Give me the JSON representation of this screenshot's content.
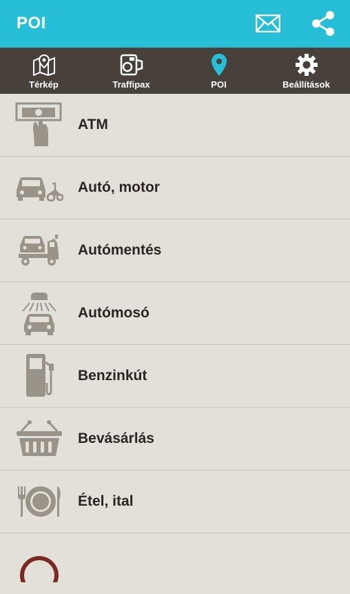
{
  "appbar": {
    "title": "POI",
    "actions": [
      {
        "icon": "mail-icon"
      },
      {
        "icon": "share-icon"
      }
    ]
  },
  "tabs": [
    {
      "label": "Térkép",
      "icon": "map-icon",
      "active": false
    },
    {
      "label": "Traffipax",
      "icon": "speed-camera-icon",
      "active": false
    },
    {
      "label": "POI",
      "icon": "location-pin-icon",
      "active": true
    },
    {
      "label": "Beállítások",
      "icon": "gear-icon",
      "active": false
    }
  ],
  "colors": {
    "appbar": "#27bfd8",
    "tabbar": "#48413b",
    "background": "#e3e0da",
    "icon_gray": "#9a938a",
    "text": "#2a2522",
    "active_tab": "#27bfd8"
  },
  "poi_list": [
    {
      "label": "ATM",
      "icon": "atm-icon"
    },
    {
      "label": "Autó, motor",
      "icon": "car-motorbike-icon"
    },
    {
      "label": "Autómentés",
      "icon": "tow-truck-icon"
    },
    {
      "label": "Autómosó",
      "icon": "car-wash-icon"
    },
    {
      "label": "Benzinkút",
      "icon": "fuel-pump-icon"
    },
    {
      "label": "Bevásárlás",
      "icon": "shopping-basket-icon"
    },
    {
      "label": "Étel, ital",
      "icon": "plate-cutlery-icon"
    },
    {
      "label": "",
      "icon": "badge-icon"
    }
  ]
}
